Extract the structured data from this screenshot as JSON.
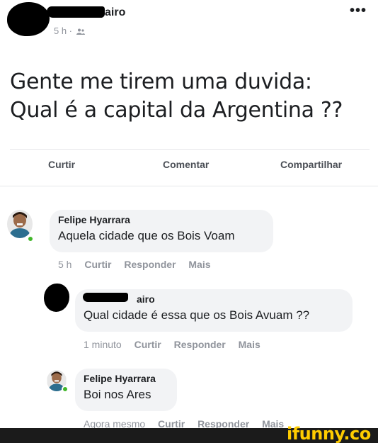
{
  "post": {
    "author": "airo",
    "time": "5 h ·",
    "audience_icon": "friends-icon",
    "more": "•••",
    "text_line1": "Gente me tirem uma duvida:",
    "text_line2": "Qual é a capital da Argentina ??"
  },
  "actions": {
    "like": "Curtir",
    "comment": "Comentar",
    "share": "Compartilhar"
  },
  "comments": [
    {
      "name": "Felipe Hyarrara",
      "text": "Aquela cidade que os Bois Voam",
      "time": "5 h",
      "like": "Curtir",
      "reply": "Responder",
      "more": "Mais"
    },
    {
      "name": "airo",
      "text": "Qual cidade é essa que os Bois Avuam ??",
      "time": "1 minuto",
      "like": "Curtir",
      "reply": "Responder",
      "more": "Mais"
    },
    {
      "name": "Felipe Hyarrara",
      "text": "Boi nos Ares",
      "time": "Agora mesmo",
      "like": "Curtir",
      "reply": "Responder",
      "more": "Mais"
    }
  ],
  "watermark": "ifunny.co",
  "colors": {
    "meta_grey": "#90949c",
    "bubble_bg": "#f2f3f5",
    "online_green": "#42b72a",
    "watermark_yellow": "#ffcc00"
  }
}
